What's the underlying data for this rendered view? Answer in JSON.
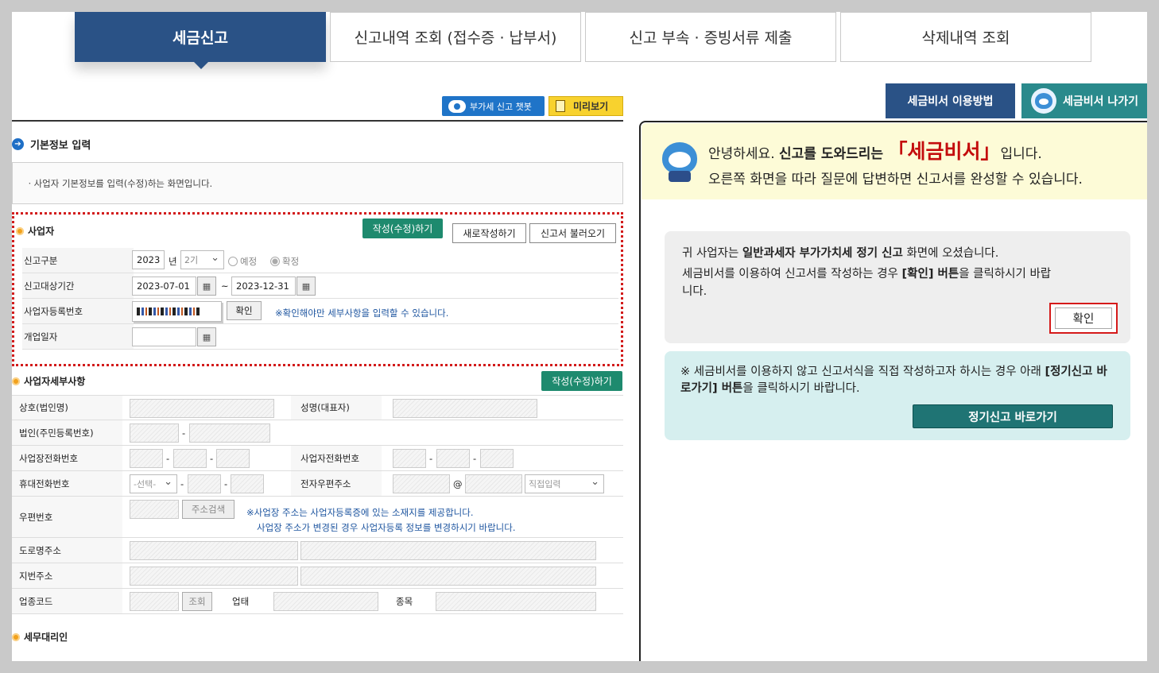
{
  "tabs": [
    {
      "label": "세금신고"
    },
    {
      "label": "신고내역 조회 (접수증 · 납부서)"
    },
    {
      "label": "신고 부속 · 증빙서류 제출"
    },
    {
      "label": "삭제내역 조회"
    }
  ],
  "toolbar": {
    "chat_label": "부가세 신고 챗봇",
    "preview_label": "미리보기"
  },
  "right_buttons": {
    "usage_label": "세금비서 이용방법",
    "exit_label": "세금비서 나가기"
  },
  "basic_info": {
    "title": "기본정보 입력",
    "info_text": "ㆍ사업자 기본정보를 입력(수정)하는 화면입니다."
  },
  "business": {
    "title": "사업자",
    "edit_label": "작성(수정)하기",
    "new_label": "새로작성하기",
    "load_label": "신고서 불러오기",
    "rows": {
      "report_type": {
        "label": "신고구분",
        "year": "2023",
        "year_unit": "년",
        "period": "2기",
        "radio1": "예정",
        "radio2": "확정"
      },
      "period": {
        "label": "신고대상기간",
        "start": "2023-07-01",
        "sep": "~",
        "end": "2023-12-31"
      },
      "brn": {
        "label": "사업자등록번호",
        "confirm_label": "확인",
        "note": "※확인해야만 세부사항을 입력할 수 있습니다."
      },
      "open_date": {
        "label": "개업일자"
      }
    }
  },
  "detail": {
    "title": "사업자세부사항",
    "edit_label": "작성(수정)하기",
    "labels": {
      "company": "상호(법인명)",
      "rep": "성명(대표자)",
      "corp_id": "법인(주민등록번호)",
      "biz_phone": "사업장전화번호",
      "biz_phone2": "사업자전화번호",
      "mobile": "휴대전화번호",
      "email": "전자우편주소",
      "zip": "우편번호",
      "road": "도로명주소",
      "jibun": "지번주소",
      "industry": "업종코드",
      "type": "업태",
      "item": "종목"
    },
    "mobile_select": "-선택-",
    "email_at": "@",
    "email_select": "직접입력",
    "addr_search": "주소검색",
    "lookup": "조회",
    "dash": "-",
    "addr_note1": "※사업장 주소는 사업자등록증에 있는 소재지를 제공합니다.",
    "addr_note2": "사업장 주소가 변경된 경우 사업자등록 정보를 변경하시기 바랍니다."
  },
  "agent": {
    "title": "세무대리인"
  },
  "assistant": {
    "greet_pre": "안녕하세요.",
    "greet_bold": "신고를 도와드리는",
    "greet_name": "「세금비서」",
    "greet_post": "입니다.",
    "greet_line2": "오른쪽 화면을 따라 질문에 답변하면 신고서를 완성할 수 있습니다.",
    "msg1_pre": "귀 사업자는",
    "msg1_bold": "일반과세자 부가가치세 정기 신고",
    "msg1_post": "화면에 오셨습니다.",
    "msg2_pre": "세금비서를 이용하여 신고서를 작성하는 경우",
    "msg2_bold": "[확인] 버튼",
    "msg2_post": "을 클릭하시기 바랍니다.",
    "ok_label": "확인",
    "direct_pre": "※ 세금비서를 이용하지 않고 신고서식을 직접 작성하고자 하시는 경우 아래",
    "direct_bold": "[정기신고 바로가기] 버튼",
    "direct_post": "을 클릭하시기 바랍니다.",
    "go_label": "정기신고 바로가기"
  },
  "colors": {
    "primary": "#2a5286",
    "accent_teal": "#2a8a8c",
    "highlight_red": "#d21b1b",
    "green_btn": "#1e8a6e"
  }
}
